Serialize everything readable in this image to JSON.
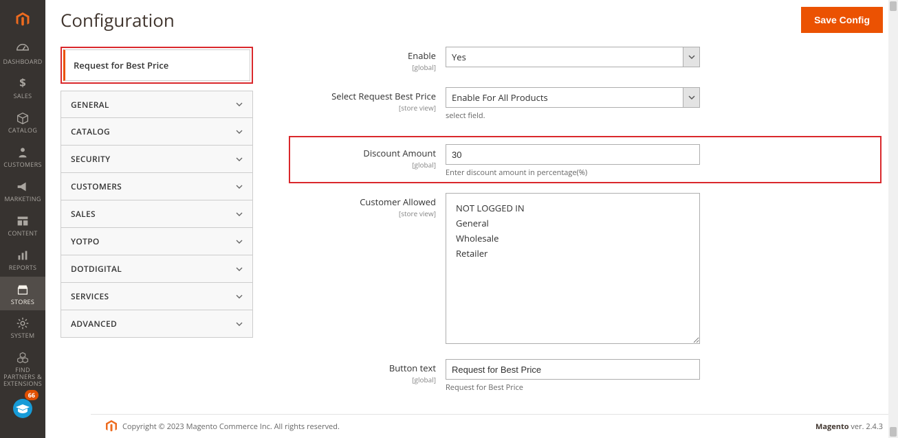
{
  "page": {
    "title": "Configuration"
  },
  "actions": {
    "save": "Save Config"
  },
  "nav": {
    "items": [
      {
        "label": "DASHBOARD",
        "icon": "dashboard-icon"
      },
      {
        "label": "SALES",
        "icon": "dollar-icon"
      },
      {
        "label": "CATALOG",
        "icon": "box-icon"
      },
      {
        "label": "CUSTOMERS",
        "icon": "person-icon"
      },
      {
        "label": "MARKETING",
        "icon": "megaphone-icon"
      },
      {
        "label": "CONTENT",
        "icon": "layout-icon"
      },
      {
        "label": "REPORTS",
        "icon": "barchart-icon"
      },
      {
        "label": "STORES",
        "icon": "storefront-icon"
      },
      {
        "label": "SYSTEM",
        "icon": "gear-icon"
      },
      {
        "label": "FIND PARTNERS & EXTENSIONS",
        "icon": "cubes-icon"
      }
    ],
    "activeIndex": 7,
    "help_badge": "66"
  },
  "config_tabs": {
    "active": "Request for Best Price",
    "sections": [
      "GENERAL",
      "CATALOG",
      "SECURITY",
      "CUSTOMERS",
      "SALES",
      "YOTPO",
      "DOTDIGITAL",
      "SERVICES",
      "ADVANCED"
    ]
  },
  "fields": {
    "enable": {
      "label": "Enable",
      "scope": "[global]",
      "value": "Yes"
    },
    "select_request": {
      "label": "Select Request Best Price",
      "scope": "[store view]",
      "value": "Enable For All Products",
      "note": "select field."
    },
    "discount": {
      "label": "Discount Amount",
      "scope": "[global]",
      "value": "30",
      "note": "Enter discount amount in percentage(%)"
    },
    "customer_allowed": {
      "label": "Customer Allowed",
      "scope": "[store view]",
      "options": [
        "NOT LOGGED IN",
        "General",
        "Wholesale",
        "Retailer"
      ]
    },
    "button_text": {
      "label": "Button text",
      "scope": "[global]",
      "value": "Request for Best Price",
      "note": "Request for Best Price"
    }
  },
  "footer": {
    "copyright": "Copyright © 2023 Magento Commerce Inc. All rights reserved.",
    "product": "Magento",
    "version": " ver. 2.4.3"
  }
}
